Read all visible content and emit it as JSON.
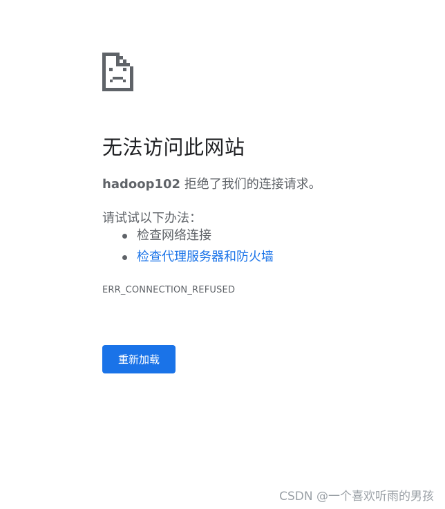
{
  "error_page": {
    "icon": "sad-page-icon",
    "title": "无法访问此网站",
    "summary_host": "hadoop102",
    "summary_text": " 拒绝了我们的连接请求。",
    "suggestions_heading": "请试试以下办法：",
    "suggestions": [
      {
        "label": "检查网络连接",
        "is_link": false
      },
      {
        "label": "检查代理服务器和防火墙",
        "is_link": true
      }
    ],
    "error_code": "ERR_CONNECTION_REFUSED",
    "reload_label": "重新加载"
  },
  "colors": {
    "accent": "#1a73e8",
    "text_primary": "#202124",
    "text_secondary": "#5f6368",
    "icon": "#5f6368"
  },
  "watermark": "CSDN @一个喜欢听雨的男孩"
}
